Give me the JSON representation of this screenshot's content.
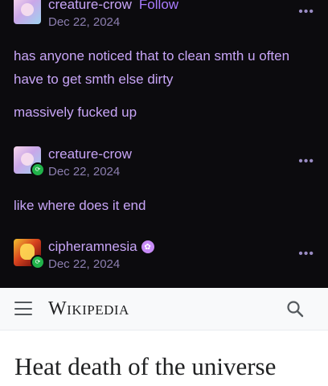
{
  "tumblr": {
    "posts": [
      {
        "username": "creature-crow",
        "follow_label": "Follow",
        "date": "Dec 22, 2024",
        "more": "•••",
        "paragraphs": [
          "has anyone noticed that to clean smth u often have to get smth else dirty",
          "massively fucked up"
        ]
      },
      {
        "username": "creature-crow",
        "date": "Dec 22, 2024",
        "more": "•••",
        "paragraphs": [
          "like where does it end"
        ]
      },
      {
        "username": "cipheramnesia",
        "date": "Dec 22, 2024",
        "more": "•••"
      }
    ]
  },
  "wikipedia": {
    "wordmark": "Wikipedia",
    "article_title": "Heat death of the universe"
  },
  "colors": {
    "tumblr_text": "#c8a5f7",
    "follow": "#a97bff",
    "reblog_green": "#21b34a",
    "wiki_bg": "#ffffff"
  }
}
